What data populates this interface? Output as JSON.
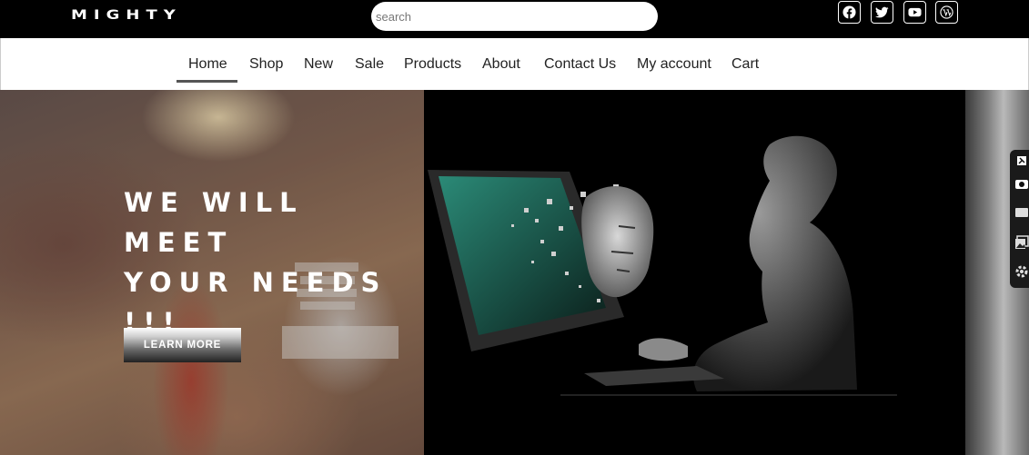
{
  "brand": {
    "logo_text": "MIGHTY"
  },
  "search": {
    "placeholder": "search"
  },
  "social": [
    {
      "icon": "facebook-icon"
    },
    {
      "icon": "twitter-icon"
    },
    {
      "icon": "youtube-icon"
    },
    {
      "icon": "wordpress-icon"
    }
  ],
  "nav": {
    "items": [
      "Home",
      "Shop",
      "New",
      "Sale",
      "Products",
      "About",
      "Contact Us",
      "My account",
      "Cart"
    ],
    "active": "Home"
  },
  "hero": {
    "headline_line1": "WE WILL MEET",
    "headline_line2": "YOUR NEEDS",
    "headline_line3": "!!!",
    "cta_label": "LEARN MORE"
  },
  "side_tools": [
    "pin-icon",
    "camera-icon",
    "message-icon",
    "gallery-icon",
    "settings-icon"
  ],
  "colors": {
    "topbar": "#000000",
    "accent_underline": "#555555",
    "screen_teal": "#1f6b5c"
  }
}
